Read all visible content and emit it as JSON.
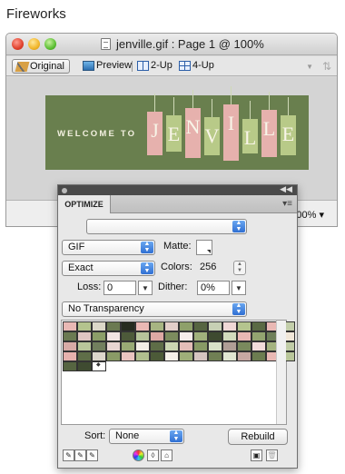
{
  "app_caption": "Fireworks",
  "window": {
    "title": "jenville.gif : Page 1 @ 100%",
    "view_tabs": [
      {
        "label": "Original",
        "icon": "pencil-icon",
        "active": true
      },
      {
        "label": "Preview",
        "icon": "preview-icon",
        "active": false
      },
      {
        "label": "2-Up",
        "icon": "two-up-icon",
        "active": false
      },
      {
        "label": "4-Up",
        "icon": "four-up-icon",
        "active": false
      }
    ],
    "status_zoom_fragment": "00%"
  },
  "canvas": {
    "banner_prefix": "WELCOME TO",
    "banner_letters": [
      "J",
      "E",
      "N",
      "V",
      "I",
      "L",
      "L",
      "E"
    ],
    "banner_tile_colors": [
      "#e6b1ad",
      "#b8ca88",
      "#e6b1ad",
      "#b8ca88",
      "#e6b1ad",
      "#b8ca88",
      "#e6b1ad",
      "#b8ca88"
    ],
    "banner_background": "#697f4e"
  },
  "panel": {
    "tab_label": "OPTIMIZE",
    "settings_preset": "",
    "format": "GIF",
    "matte_label": "Matte:",
    "palette": "Exact",
    "colors_label": "Colors:",
    "colors_value": "256",
    "loss_label": "Loss:",
    "loss_value": "0",
    "dither_label": "Dither:",
    "dither_value": "0%",
    "transparency": "No Transparency",
    "sort_label": "Sort:",
    "sort_value": "None",
    "rebuild_label": "Rebuild",
    "color_table": [
      "#e9b8b4",
      "#b4c48e",
      "#dcd8c8",
      "#6b7a52",
      "#262c20",
      "#e9b8b4",
      "#a7b582",
      "#e3cfc9",
      "#8ea06a",
      "#566541",
      "#c7d0b4",
      "#f0d8d6",
      "#b4c48e",
      "#5a6a44",
      "#e9b8b4",
      "#c3ceaa",
      "#6b7a52",
      "#e0c6c2",
      "#8c9e68",
      "#f2e4e2",
      "#4d5a3a",
      "#b6c49a",
      "#dea9a4",
      "#7c8c5e",
      "#f6ecea",
      "#a0b07c",
      "#3e4a30",
      "#d2dbbd",
      "#e9b8b4",
      "#93a470",
      "#6f805a",
      "#f1e7d9",
      "#d8aaa6",
      "#b9c69a",
      "#727f5e",
      "#e8d5d2",
      "#99aa75",
      "#f3eee6",
      "#5e6d47",
      "#cbd6b1",
      "#e4bdb8",
      "#889a65",
      "#d9e1c8",
      "#b09e96",
      "#7a8a5d",
      "#f2dcda",
      "#a4b37f",
      "#c0cca6",
      "#e6b1ad",
      "#5f6e48",
      "#dcd6cb",
      "#8a9b66",
      "#eac4c0",
      "#b1bf8e",
      "#4c5a38",
      "#f6f1ea",
      "#9eae79",
      "#d5c4c0",
      "#707f54",
      "#e0e6d2",
      "#c8a8a3",
      "#6c7c50",
      "#e9b8b4",
      "#b9c69a",
      "#566541",
      "#3f4b31",
      "#ffffff"
    ],
    "color_table_marked_index": 66
  }
}
